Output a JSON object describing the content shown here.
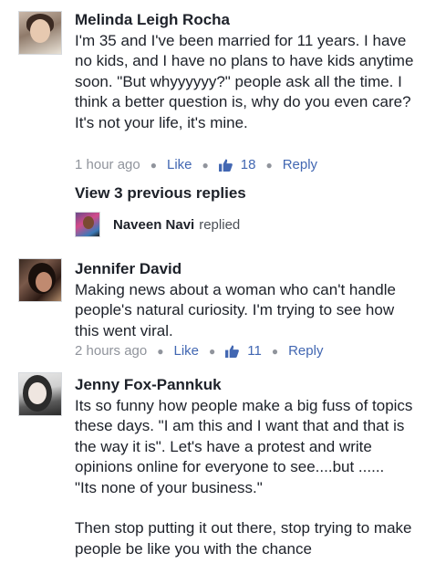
{
  "comments": [
    {
      "author": "Melinda Leigh Rocha",
      "avatar_icon": "profile-photo",
      "text": "I'm 35 and I've been married for 11 years. I have no kids, and I have no plans to have kids anytime soon. \"But whyyyyyy?\" people ask all the time. I think a better question is, why do you even care? It's not your life, it's mine.",
      "time": "1 hour ago",
      "like_label": "Like",
      "like_count": "18",
      "reply_label": "Reply"
    },
    {
      "author": "Jennifer David",
      "avatar_icon": "profile-photo",
      "text": "Making news about a woman who can't handle people's natural curiosity. I'm trying to see how this went viral.",
      "time": "2 hours ago",
      "like_label": "Like",
      "like_count": "11",
      "reply_label": "Reply"
    },
    {
      "author": "Jenny Fox-Pannkuk",
      "avatar_icon": "profile-photo",
      "text": "Its so funny how people make a big fuss of topics these days.  \"I am this and I want that and that is the way it is\". Let's have a protest and write opinions online for everyone to see....but ......\n\"Its none of your business.\"\n\nThen stop putting it out there, stop trying to make people be like you with the chance"
    }
  ],
  "replies_summary": {
    "view_label": "View 3 previous replies",
    "replier_name": "Naveen Navi",
    "replied_label": "replied"
  },
  "colors": {
    "link": "#4267b2",
    "meta": "#90949c",
    "text": "#1d2129"
  }
}
